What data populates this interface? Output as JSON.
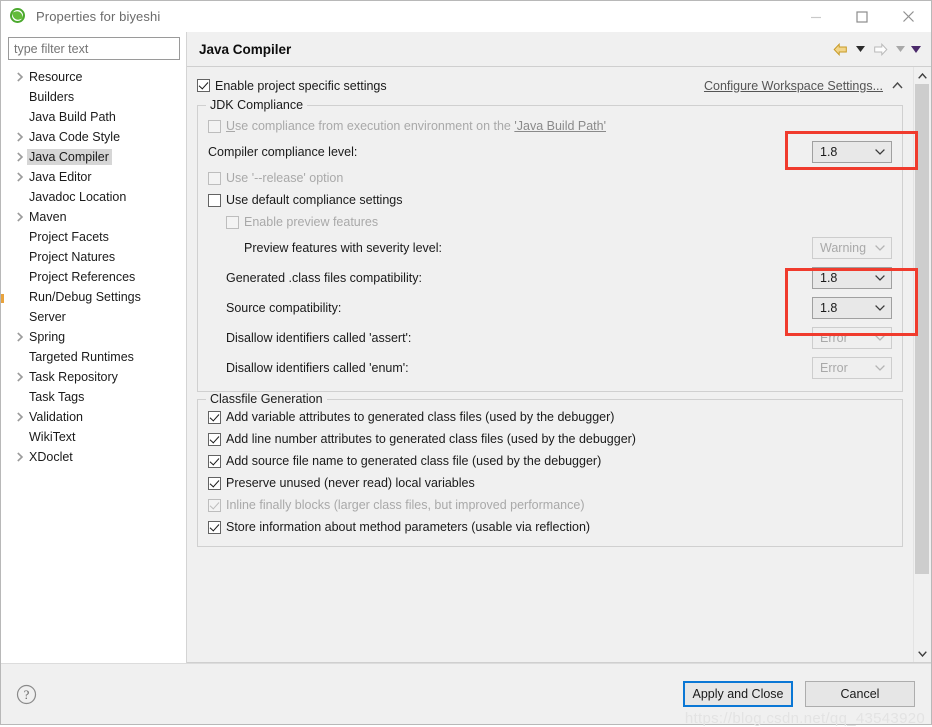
{
  "window": {
    "title": "Properties for biyeshi",
    "icon": "eclipse-icon",
    "controls": {
      "minimize": "minimize-icon",
      "maximize": "maximize-icon",
      "close": "close-icon"
    }
  },
  "sidebar": {
    "filter": {
      "value": "",
      "placeholder": "type filter text"
    },
    "items": [
      {
        "label": "Resource",
        "expandable": true,
        "selected": false
      },
      {
        "label": "Builders",
        "expandable": false,
        "selected": false
      },
      {
        "label": "Java Build Path",
        "expandable": false,
        "selected": false
      },
      {
        "label": "Java Code Style",
        "expandable": true,
        "selected": false
      },
      {
        "label": "Java Compiler",
        "expandable": true,
        "selected": true
      },
      {
        "label": "Java Editor",
        "expandable": true,
        "selected": false
      },
      {
        "label": "Javadoc Location",
        "expandable": false,
        "selected": false
      },
      {
        "label": "Maven",
        "expandable": true,
        "selected": false
      },
      {
        "label": "Project Facets",
        "expandable": false,
        "selected": false
      },
      {
        "label": "Project Natures",
        "expandable": false,
        "selected": false
      },
      {
        "label": "Project References",
        "expandable": false,
        "selected": false
      },
      {
        "label": "Run/Debug Settings",
        "expandable": false,
        "selected": false
      },
      {
        "label": "Server",
        "expandable": false,
        "selected": false
      },
      {
        "label": "Spring",
        "expandable": true,
        "selected": false
      },
      {
        "label": "Targeted Runtimes",
        "expandable": false,
        "selected": false
      },
      {
        "label": "Task Repository",
        "expandable": true,
        "selected": false
      },
      {
        "label": "Task Tags",
        "expandable": false,
        "selected": false
      },
      {
        "label": "Validation",
        "expandable": true,
        "selected": false
      },
      {
        "label": "WikiText",
        "expandable": false,
        "selected": false
      },
      {
        "label": "XDoclet",
        "expandable": true,
        "selected": false
      }
    ]
  },
  "page": {
    "title": "Java Compiler",
    "nav": {
      "back_icon": "back-arrow-icon",
      "back_caret_icon": "chevron-down-icon",
      "forward_icon": "forward-arrow-icon",
      "forward_caret_icon": "chevron-down-icon",
      "menu_caret_icon": "chevron-down-icon"
    },
    "enable_project_specific": {
      "label": "Enable project specific settings",
      "checked": true
    },
    "configure_workspace_link": "Configure Workspace Settings...",
    "collapse_icon": "chevron-up-icon",
    "jdk_compliance": {
      "title": "JDK Compliance",
      "use_compliance_from_ee": {
        "label_before": "Use compliance from execution environment on the ",
        "label_link": "'Java Build Path'",
        "mnemonic": "U",
        "label_rest": "se compliance from execution environment on the ",
        "checked": false,
        "enabled": false
      },
      "rows": [
        {
          "label": "Compiler compliance level:",
          "value": "1.8",
          "enabled": true,
          "highlighted": true,
          "indent": 0
        },
        {
          "label": "Preview features with severity level:",
          "value": "Warning",
          "enabled": false,
          "highlighted": false,
          "indent": 2
        },
        {
          "label": "Generated .class files compatibility:",
          "value": "1.8",
          "enabled": true,
          "highlighted": true,
          "indent": 1
        },
        {
          "label": "Source compatibility:",
          "value": "1.8",
          "enabled": true,
          "highlighted": true,
          "indent": 1
        },
        {
          "label": "Disallow identifiers called 'assert':",
          "value": "Error",
          "enabled": false,
          "highlighted": false,
          "indent": 1
        },
        {
          "label": "Disallow identifiers called 'enum':",
          "value": "Error",
          "enabled": false,
          "highlighted": false,
          "indent": 1
        }
      ],
      "use_release_option": {
        "label": "Use '--release' option",
        "checked": false,
        "enabled": false
      },
      "use_default_compliance": {
        "label": "Use default compliance settings",
        "checked": false,
        "enabled": true
      },
      "enable_preview_features": {
        "label": "Enable preview features",
        "checked": false,
        "enabled": false
      }
    },
    "classfile_generation": {
      "title": "Classfile Generation",
      "items": [
        {
          "label": "Add variable attributes to generated class files (used by the debugger)",
          "checked": true,
          "enabled": true
        },
        {
          "label": "Add line number attributes to generated class files (used by the debugger)",
          "checked": true,
          "enabled": true
        },
        {
          "label": "Add source file name to generated class file (used by the debugger)",
          "checked": true,
          "enabled": true
        },
        {
          "label": "Preserve unused (never read) local variables",
          "checked": true,
          "enabled": true
        },
        {
          "label": "Inline finally blocks (larger class files, but improved performance)",
          "checked": true,
          "enabled": false
        },
        {
          "label": "Store information about method parameters (usable via reflection)",
          "checked": true,
          "enabled": true
        }
      ]
    },
    "scrollbar": {
      "up_icon": "chevron-up-icon",
      "down_icon": "chevron-down-icon"
    }
  },
  "footer": {
    "help_icon": "help-icon",
    "apply_and_close": "Apply and Close",
    "cancel": "Cancel",
    "watermark": "https://blog.csdn.net/qq_43543920"
  },
  "colors": {
    "accent_highlight": "#f03b2d",
    "focus_border": "#0a77d5",
    "back_arrow": "#e8b53a",
    "dialog_bg": "#f0f0f0"
  }
}
